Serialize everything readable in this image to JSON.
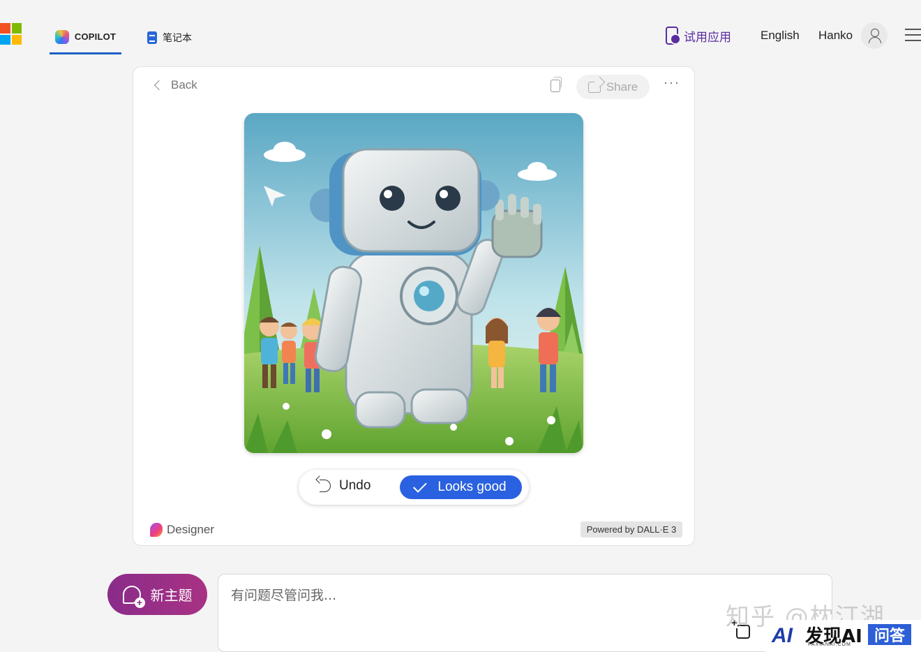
{
  "header": {
    "tabs": [
      {
        "label": "COPILOT",
        "active": true
      },
      {
        "label": "笔记本",
        "active": false
      }
    ],
    "try_app_label": "试用应用",
    "language_label": "English",
    "user_name": "Hanko",
    "colors": {
      "accent": "#1d5fc5",
      "try_app": "#5a2ca0"
    }
  },
  "card": {
    "back_label": "Back",
    "share_label": "Share",
    "more_label": "···",
    "image_alt": "Friendly robot waving to children in a grassy field",
    "undo_label": "Undo",
    "looks_good_label": "Looks good",
    "designer_label": "Designer",
    "powered_label": "Powered by DALL·E 3",
    "colors": {
      "primary_button": "#2a61e0"
    }
  },
  "composer": {
    "new_topic_label": "新主题",
    "placeholder": "有问题尽管问我...",
    "colors": {
      "new_topic": "#8a2c8a"
    }
  },
  "watermarks": {
    "zhihu": "知乎 @枕汀湖",
    "faxian_main": "发现AI",
    "faxian_ai": "AI",
    "faxian_sub": "FAXIANAI.COM",
    "wenda": "问答"
  }
}
